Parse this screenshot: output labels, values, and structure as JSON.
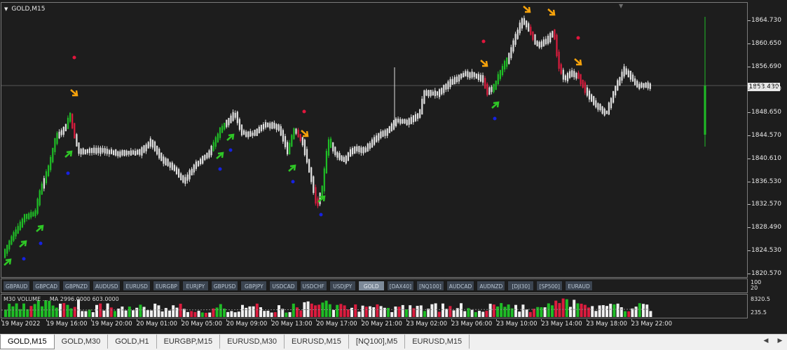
{
  "chart": {
    "title": "GOLD,M15",
    "current_price": "1853.430",
    "price_levels": [
      "1864.730",
      "1860.650",
      "1856.690",
      "1852.610",
      "1848.650",
      "1844.570",
      "1840.610",
      "1836.530",
      "1832.570",
      "1828.490",
      "1824.530",
      "1820.570"
    ],
    "colors": {
      "bull": "#1fbd26",
      "bear": "#dc1c3e",
      "neutral": "#e0e0e0",
      "dot_red": "#e0163c",
      "dot_blue": "#1622e0",
      "arrow_up": "#2fc626",
      "arrow_down": "#f6a20b"
    }
  },
  "symbols": [
    "GBPAUD",
    "GBPCAD",
    "GBPNZD",
    "AUDUSD",
    "EURUSD",
    "EURGBP",
    "EURJPY",
    "GBPUSD",
    "GBPJPY",
    "USDCAD",
    "USDCHF",
    "USDJPY",
    "GOLD",
    "[DAX40]",
    "[NQ100]",
    "AUDCAD",
    "AUDNZD",
    "[DJI30]",
    "[SP500]",
    "EURAUD"
  ],
  "active_symbol": "GOLD",
  "volume": {
    "label": "M30 VOLUME ... MA 2996.0000 603.0000",
    "scale_top": "100",
    "scale_mid": "20",
    "scale_a": "8320.5",
    "scale_b": "235.5"
  },
  "time_labels": [
    "19 May 2022",
    "19 May 16:00",
    "19 May 20:00",
    "20 May 01:00",
    "20 May 05:00",
    "20 May 09:00",
    "20 May 13:00",
    "20 May 17:00",
    "20 May 21:00",
    "23 May 02:00",
    "23 May 06:00",
    "23 May 10:00",
    "23 May 14:00",
    "23 May 18:00",
    "23 May 22:00"
  ],
  "tabs": [
    "GOLD,M15",
    "GOLD,M30",
    "GOLD,H1",
    "EURGBP,M15",
    "EURUSD,M30",
    "EURUSD,M15",
    "[NQ100],M5",
    "EURUSD,M15"
  ],
  "active_tab": "GOLD,M15",
  "icons": {
    "scroll_left": "triangle-left-icon",
    "scroll_right": "triangle-right-icon",
    "collapse": "triangle-down-icon"
  }
}
